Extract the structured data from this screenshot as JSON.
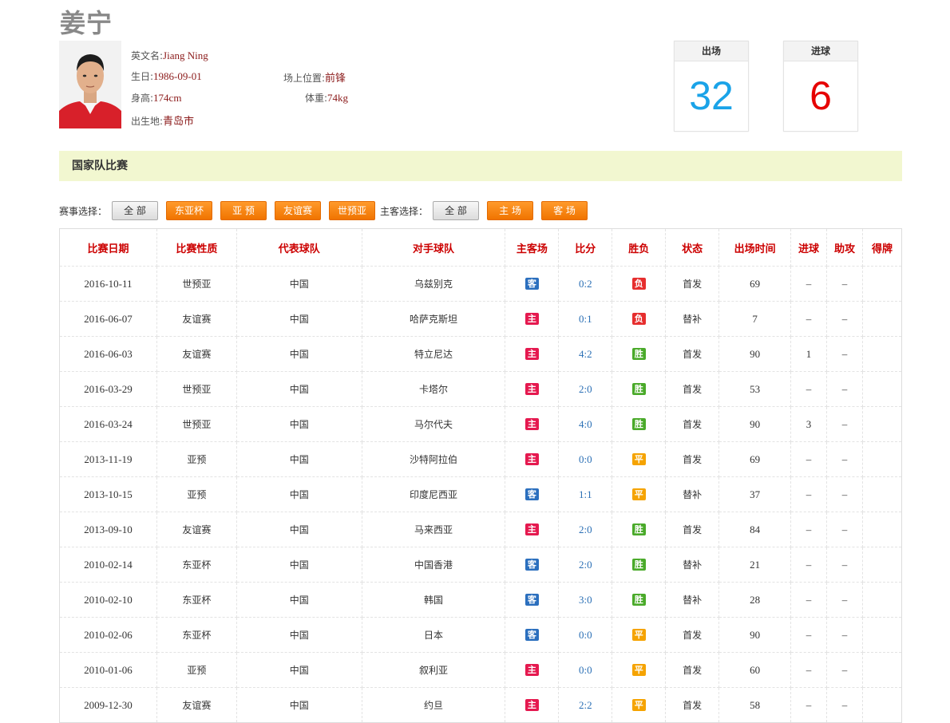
{
  "player": {
    "name": "姜宁",
    "english_label": "英文名:",
    "english_name": "Jiang Ning",
    "birthday_label": "生日:",
    "birthday": "1986-09-01",
    "position_label": "场上位置:",
    "position": "前锋",
    "height_label": "身高:",
    "height": "174cm",
    "weight_label": "体重:",
    "weight": "74kg",
    "birthplace_label": "出生地:",
    "birthplace": "青岛市"
  },
  "stats": {
    "appearances_label": "出场",
    "appearances": "32",
    "appearances_color": "#1aa3e8",
    "goals_label": "进球",
    "goals": "6",
    "goals_color": "#e60000"
  },
  "section_title": "国家队比赛",
  "filters": {
    "event_label": "赛事选择：",
    "event_buttons": [
      "全 部",
      "东亚杯",
      "亚 预",
      "友谊赛",
      "世预亚"
    ],
    "venue_label": "主客选择：",
    "venue_buttons": [
      "全 部",
      "主 场",
      "客 场"
    ]
  },
  "colors": {
    "home_tag": "#e5194f",
    "away_tag": "#2b6fbe",
    "win_tag": "#4aaa2a",
    "draw_tag": "#f5a300",
    "loss_tag": "#e62e2e"
  },
  "table": {
    "headers": [
      "比赛日期",
      "比赛性质",
      "代表球队",
      "对手球队",
      "主客场",
      "比分",
      "胜负",
      "状态",
      "出场时间",
      "进球",
      "助攻",
      "得牌"
    ],
    "rows": [
      {
        "date": "2016-10-11",
        "type": "世预亚",
        "team": "中国",
        "opponent": "乌兹别克",
        "venue": "客",
        "score": "0:2",
        "result": "负",
        "status": "首发",
        "minutes": "69",
        "goals": "–",
        "assists": "–",
        "cards": ""
      },
      {
        "date": "2016-06-07",
        "type": "友谊赛",
        "team": "中国",
        "opponent": "哈萨克斯坦",
        "venue": "主",
        "score": "0:1",
        "result": "负",
        "status": "替补",
        "minutes": "7",
        "goals": "–",
        "assists": "–",
        "cards": ""
      },
      {
        "date": "2016-06-03",
        "type": "友谊赛",
        "team": "中国",
        "opponent": "特立尼达",
        "venue": "主",
        "score": "4:2",
        "result": "胜",
        "status": "首发",
        "minutes": "90",
        "goals": "1",
        "assists": "–",
        "cards": ""
      },
      {
        "date": "2016-03-29",
        "type": "世预亚",
        "team": "中国",
        "opponent": "卡塔尔",
        "venue": "主",
        "score": "2:0",
        "result": "胜",
        "status": "首发",
        "minutes": "53",
        "goals": "–",
        "assists": "–",
        "cards": ""
      },
      {
        "date": "2016-03-24",
        "type": "世预亚",
        "team": "中国",
        "opponent": "马尔代夫",
        "venue": "主",
        "score": "4:0",
        "result": "胜",
        "status": "首发",
        "minutes": "90",
        "goals": "3",
        "assists": "–",
        "cards": ""
      },
      {
        "date": "2013-11-19",
        "type": "亚预",
        "team": "中国",
        "opponent": "沙特阿拉伯",
        "venue": "主",
        "score": "0:0",
        "result": "平",
        "status": "首发",
        "minutes": "69",
        "goals": "–",
        "assists": "–",
        "cards": ""
      },
      {
        "date": "2013-10-15",
        "type": "亚预",
        "team": "中国",
        "opponent": "印度尼西亚",
        "venue": "客",
        "score": "1:1",
        "result": "平",
        "status": "替补",
        "minutes": "37",
        "goals": "–",
        "assists": "–",
        "cards": ""
      },
      {
        "date": "2013-09-10",
        "type": "友谊赛",
        "team": "中国",
        "opponent": "马来西亚",
        "venue": "主",
        "score": "2:0",
        "result": "胜",
        "status": "首发",
        "minutes": "84",
        "goals": "–",
        "assists": "–",
        "cards": ""
      },
      {
        "date": "2010-02-14",
        "type": "东亚杯",
        "team": "中国",
        "opponent": "中国香港",
        "venue": "客",
        "score": "2:0",
        "result": "胜",
        "status": "替补",
        "minutes": "21",
        "goals": "–",
        "assists": "–",
        "cards": ""
      },
      {
        "date": "2010-02-10",
        "type": "东亚杯",
        "team": "中国",
        "opponent": "韩国",
        "venue": "客",
        "score": "3:0",
        "result": "胜",
        "status": "替补",
        "minutes": "28",
        "goals": "–",
        "assists": "–",
        "cards": ""
      },
      {
        "date": "2010-02-06",
        "type": "东亚杯",
        "team": "中国",
        "opponent": "日本",
        "venue": "客",
        "score": "0:0",
        "result": "平",
        "status": "首发",
        "minutes": "90",
        "goals": "–",
        "assists": "–",
        "cards": ""
      },
      {
        "date": "2010-01-06",
        "type": "亚预",
        "team": "中国",
        "opponent": "叙利亚",
        "venue": "主",
        "score": "0:0",
        "result": "平",
        "status": "首发",
        "minutes": "60",
        "goals": "–",
        "assists": "–",
        "cards": ""
      },
      {
        "date": "2009-12-30",
        "type": "友谊赛",
        "team": "中国",
        "opponent": "约旦",
        "venue": "主",
        "score": "2:2",
        "result": "平",
        "status": "首发",
        "minutes": "58",
        "goals": "–",
        "assists": "–",
        "cards": ""
      }
    ]
  }
}
